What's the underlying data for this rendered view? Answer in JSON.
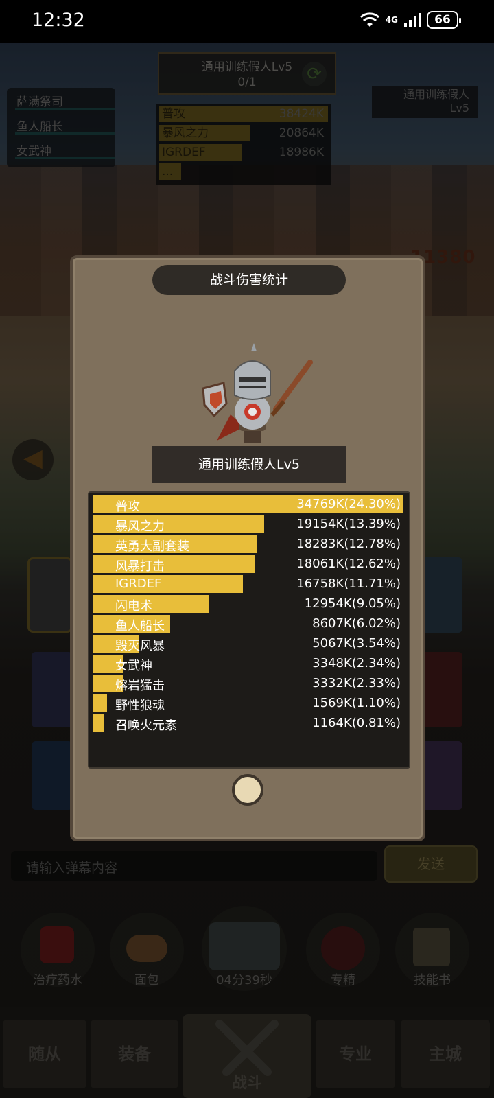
{
  "status_bar": {
    "time": "12:32",
    "network": "4G",
    "battery": "66",
    "icons": [
      "wifi-icon",
      "signal-icon",
      "battery-icon"
    ]
  },
  "background": {
    "boss_box": {
      "name": "通用训练假人Lv5",
      "progress": "0/1"
    },
    "ally_list": [
      "萨满祭司",
      "鱼人船长",
      "女武神"
    ],
    "target_box": {
      "name": "通用训练假人",
      "level": "Lv5"
    },
    "mini_stats": [
      {
        "label": "普攻",
        "value": "38424K",
        "fraction": 1.0
      },
      {
        "label": "暴风之力",
        "value": "20864K",
        "fraction": 0.54
      },
      {
        "label": "IGRDEF",
        "value": "18986K",
        "fraction": 0.49
      },
      {
        "label": "...",
        "value": "",
        "fraction": 0.13
      }
    ],
    "floating_damage": "11380",
    "chat": {
      "placeholder": "请输入弹幕内容",
      "send_label": "发送"
    },
    "items": [
      {
        "label": "治疗药水",
        "icon": "potion-icon"
      },
      {
        "label": "面包",
        "icon": "bread-icon"
      },
      {
        "label": "04分39秒",
        "icon": "chest-icon"
      },
      {
        "label": "专精",
        "icon": "target-icon"
      },
      {
        "label": "技能书",
        "icon": "book-icon"
      }
    ],
    "nav_tabs": [
      "随从",
      "装备",
      "战斗",
      "专业",
      "主城"
    ],
    "active_tab": "战斗"
  },
  "modal": {
    "title": "战斗伤害统计",
    "target_name": "通用训练假人Lv5",
    "rows": [
      {
        "label": "普攻",
        "value": "34769K(24.30%)",
        "fraction": 1.0
      },
      {
        "label": "暴风之力",
        "value": "19154K(13.39%)",
        "fraction": 0.551
      },
      {
        "label": "英勇大副套装",
        "value": "18283K(12.78%)",
        "fraction": 0.526
      },
      {
        "label": "风暴打击",
        "value": "18061K(12.62%)",
        "fraction": 0.519
      },
      {
        "label": "IGRDEF",
        "value": "16758K(11.71%)",
        "fraction": 0.482
      },
      {
        "label": "闪电术",
        "value": "12954K(9.05%)",
        "fraction": 0.373
      },
      {
        "label": "鱼人船长",
        "value": "8607K(6.02%)",
        "fraction": 0.248
      },
      {
        "label": "毁灭风暴",
        "value": "5067K(3.54%)",
        "fraction": 0.146
      },
      {
        "label": "女武神",
        "value": "3348K(2.34%)",
        "fraction": 0.096
      },
      {
        "label": "熔岩猛击",
        "value": "3332K(2.33%)",
        "fraction": 0.096
      },
      {
        "label": "野性狼魂",
        "value": "1569K(1.10%)",
        "fraction": 0.045
      },
      {
        "label": "召唤火元素",
        "value": "1164K(0.81%)",
        "fraction": 0.034
      }
    ]
  }
}
